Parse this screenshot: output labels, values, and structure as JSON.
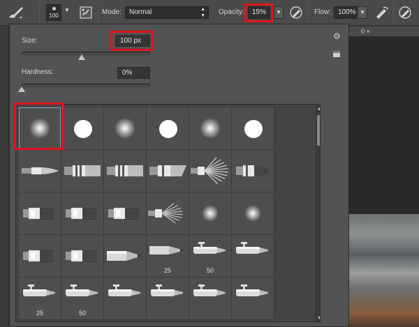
{
  "options_bar": {
    "brush_size": "100",
    "mode_label": "Mode:",
    "mode_value": "Normal",
    "opacity_label": "Opacity:",
    "opacity_value": "15%",
    "flow_label": "Flow:",
    "flow_value": "100%"
  },
  "document_tab": {
    "close": "0 ×"
  },
  "brush_panel": {
    "size_label": "Size:",
    "size_value": "100 px",
    "size_level": 0.47,
    "hardness_label": "Hardness:",
    "hardness_value": "0%",
    "hardness_level": 0.0,
    "presets": [
      {
        "kind": "soft",
        "caption": ""
      },
      {
        "kind": "hard",
        "caption": ""
      },
      {
        "kind": "soft",
        "caption": ""
      },
      {
        "kind": "hard",
        "caption": ""
      },
      {
        "kind": "soft",
        "caption": ""
      },
      {
        "kind": "hard",
        "caption": ""
      },
      {
        "kind": "round-tip",
        "caption": ""
      },
      {
        "kind": "flat-banded",
        "caption": ""
      },
      {
        "kind": "flat-banded",
        "caption": ""
      },
      {
        "kind": "angled-banded",
        "caption": ""
      },
      {
        "kind": "fan",
        "caption": ""
      },
      {
        "kind": "bristle",
        "caption": ""
      },
      {
        "kind": "bristle-cube",
        "caption": ""
      },
      {
        "kind": "bristle-cube",
        "caption": ""
      },
      {
        "kind": "bristle-cube",
        "caption": ""
      },
      {
        "kind": "fan-small",
        "caption": ""
      },
      {
        "kind": "soft-small",
        "caption": ""
      },
      {
        "kind": "soft-small",
        "caption": ""
      },
      {
        "kind": "bristle-cube",
        "caption": ""
      },
      {
        "kind": "bristle-cube",
        "caption": ""
      },
      {
        "kind": "pencil",
        "caption": ""
      },
      {
        "kind": "pencil-flat",
        "caption": "25"
      },
      {
        "kind": "airbrush",
        "caption": "50"
      },
      {
        "kind": "airbrush",
        "caption": ""
      },
      {
        "kind": "airbrush",
        "caption": "25"
      },
      {
        "kind": "airbrush",
        "caption": "50"
      },
      {
        "kind": "airbrush",
        "caption": ""
      },
      {
        "kind": "airbrush",
        "caption": ""
      },
      {
        "kind": "airbrush",
        "caption": ""
      },
      {
        "kind": "airbrush",
        "caption": ""
      }
    ]
  }
}
